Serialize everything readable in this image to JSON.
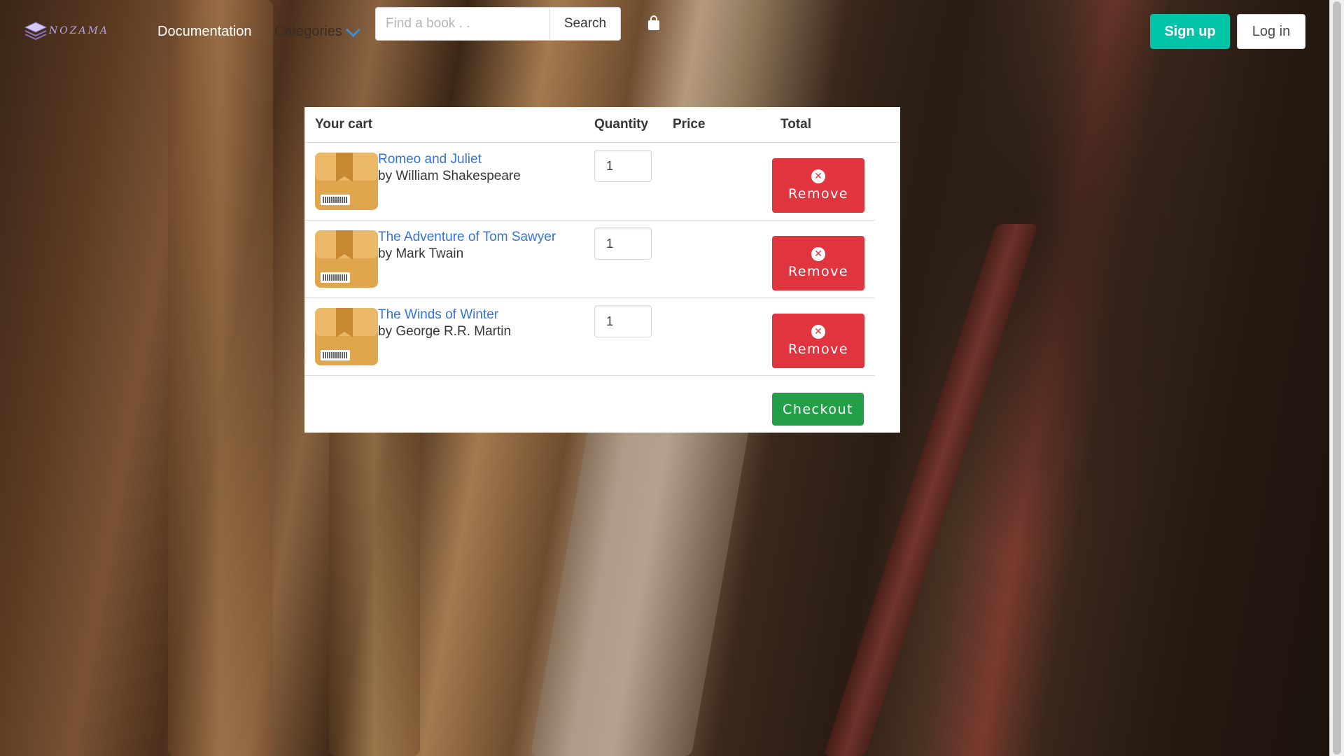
{
  "nav": {
    "logo_text": "NOZAMA",
    "documentation": "Documentation",
    "categories": "Categories",
    "search_placeholder": "Find a book . .",
    "search_label": "Search",
    "signup": "Sign up",
    "login": "Log in"
  },
  "cart": {
    "headers": {
      "item": "Your cart",
      "quantity": "Quantity",
      "price": "Price",
      "total": "Total"
    },
    "items": [
      {
        "title": "Romeo and Juliet",
        "author": "by William Shakespeare",
        "quantity": "1",
        "remove_label": "Remove"
      },
      {
        "title": "The Adventure of Tom Sawyer",
        "author": "by Mark Twain",
        "quantity": "1",
        "remove_label": "Remove"
      },
      {
        "title": "The Winds of Winter",
        "author": "by George R.R. Martin",
        "quantity": "1",
        "remove_label": "Remove"
      }
    ],
    "checkout_label": "Checkout"
  },
  "colors": {
    "signup": "#00c4a7",
    "remove": "#e0343f",
    "checkout": "#23a047",
    "link": "#3273dc",
    "logo": "#b9a4e8"
  },
  "icons": [
    "logo-stack-icon",
    "chevron-down-icon",
    "shopping-bag-icon",
    "package-icon",
    "close-circle-icon"
  ]
}
